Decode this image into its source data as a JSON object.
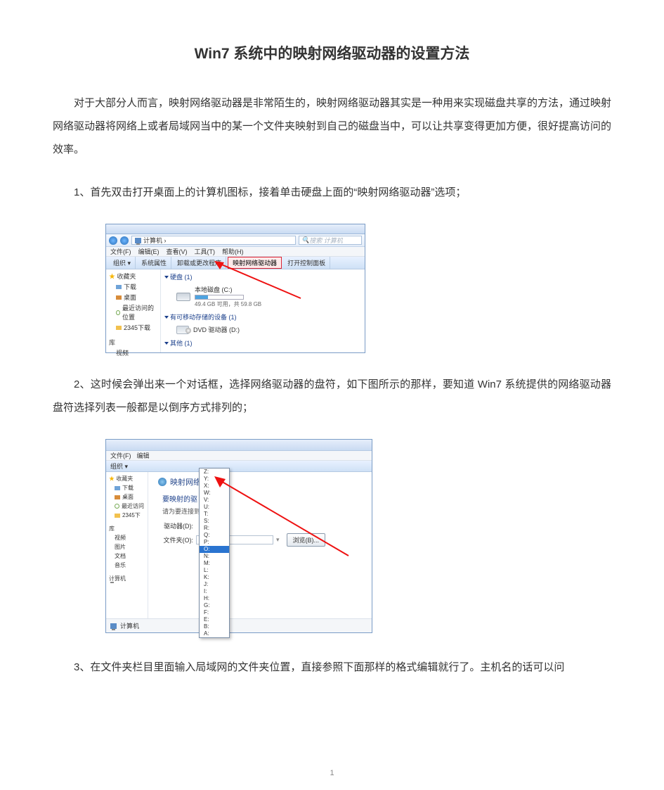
{
  "title": "Win7 系统中的映射网络驱动器的设置方法",
  "intro": "对于大部分人而言，映射网络驱动器是非常陌生的，映射网络驱动器其实是一种用来实现磁盘共享的方法，通过映射网络驱动器将网络上或者局域网当中的某一个文件夹映射到自己的磁盘当中，可以让共享变得更加方便，很好提高访问的效率。",
  "step1": "1、首先双击打开桌面上的计算机图标，接着单击硬盘上面的“映射网络驱动器”选项；",
  "step2": "2、这时候会弹出来一个对话框，选择网络驱动器的盘符，如下图所示的那样，要知道 Win7 系统提供的网络驱动器盘符选择列表一般都是以倒序方式排列的；",
  "step3": "3、在文件夹栏目里面输入局域网的文件夹位置，直接参照下面那样的格式编辑就行了。主机名的话可以问",
  "page_number": "1",
  "shot1": {
    "breadcrumb": "计算机 ›",
    "search_placeholder": "搜索 计算机",
    "menus": [
      "文件(F)",
      "编辑(E)",
      "查看(V)",
      "工具(T)",
      "帮助(H)"
    ],
    "toolbar": {
      "org": "组织 ▾",
      "props": "系统属性",
      "uninstall": "卸载或更改程序",
      "map": "映射网络驱动器",
      "cpanel": "打开控制面板"
    },
    "sidebar": {
      "fav_header": "收藏夹",
      "items": [
        "下载",
        "桌面",
        "最近访问的位置",
        "2345下载"
      ],
      "lib_header": "库",
      "libs": [
        "视频"
      ]
    },
    "groups": {
      "hdd": "硬盘 (1)",
      "hdd_name": "本地磁盘 (C:)",
      "hdd_cap": "49.4 GB 可用，共 59.8 GB",
      "removable": "有可移动存储的设备 (1)",
      "dvd": "DVD 驱动器 (D:)",
      "other": "其他 (1)"
    }
  },
  "shot2": {
    "menus": [
      "文件(F)",
      "编辑"
    ],
    "org": "组织 ▾",
    "panel_title": "映射网络",
    "question": "要映射的驱",
    "subtitle": "请为要连接到",
    "drive_label": "驱动器(D):",
    "folder_label": "文件夹(O):",
    "browse": "浏览(B)...",
    "sidebar": {
      "fav_header": "收藏夹",
      "items": [
        "下载",
        "桌面",
        "最近访问",
        "2345下"
      ],
      "lib_header": "库",
      "libs": [
        "视频",
        "图片",
        "文档",
        "音乐"
      ],
      "computer": "计算机"
    },
    "drives": [
      "Z:",
      "Y:",
      "X:",
      "W:",
      "V:",
      "U:",
      "T:",
      "S:",
      "R:",
      "Q:",
      "P:",
      "O:",
      "N:",
      "M:",
      "L:",
      "K:",
      "J:",
      "I:",
      "H:",
      "G:",
      "F:",
      "E:",
      "B:",
      "A:"
    ],
    "selected_drive": "O:"
  }
}
